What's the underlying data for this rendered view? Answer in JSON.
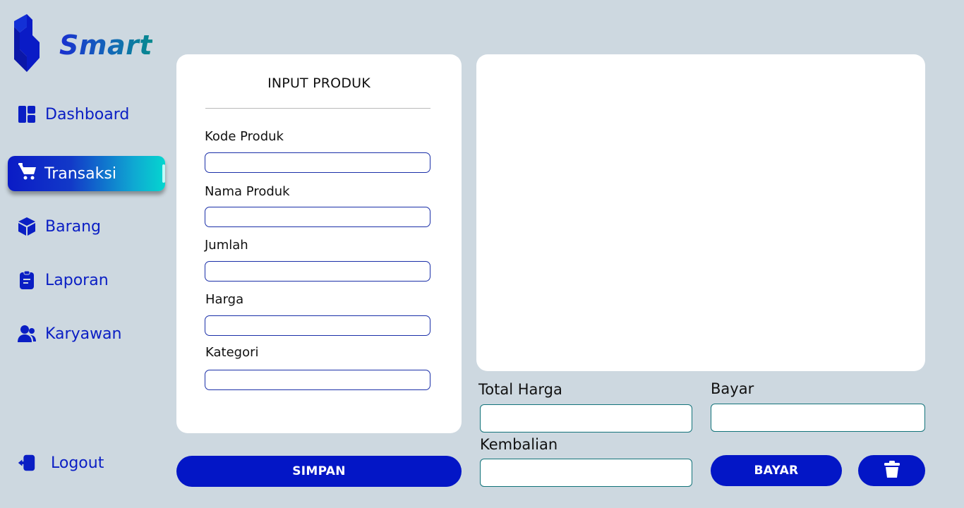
{
  "app": {
    "brand": "Smart"
  },
  "colors": {
    "primary": "#0316c6",
    "nav_text": "#0a1ec4",
    "background": "#cdd8e0",
    "accent_teal": "#05d6cf"
  },
  "sidebar": {
    "items": [
      {
        "label": "Dashboard",
        "icon": "dashboard-icon",
        "active": false
      },
      {
        "label": "Transaksi",
        "icon": "cart-icon",
        "active": true
      },
      {
        "label": "Barang",
        "icon": "box-icon",
        "active": false
      },
      {
        "label": "Laporan",
        "icon": "clipboard-icon",
        "active": false
      },
      {
        "label": "Karyawan",
        "icon": "users-icon",
        "active": false
      }
    ],
    "logout": {
      "label": "Logout",
      "icon": "logout-icon"
    }
  },
  "form": {
    "title": "INPUT PRODUK",
    "fields": [
      {
        "label": "Kode Produk",
        "value": ""
      },
      {
        "label": "Nama Produk",
        "value": ""
      },
      {
        "label": "Jumlah",
        "value": ""
      },
      {
        "label": "Harga",
        "value": ""
      },
      {
        "label": "Kategori",
        "value": ""
      }
    ],
    "save_label": "SIMPAN"
  },
  "payment": {
    "total_label": "Total Harga",
    "total_value": "",
    "bayar_label": "Bayar",
    "bayar_value": "",
    "kembalian_label": "Kembalian",
    "kembalian_value": "",
    "pay_button": "BAYAR",
    "delete_icon": "trash-icon"
  }
}
